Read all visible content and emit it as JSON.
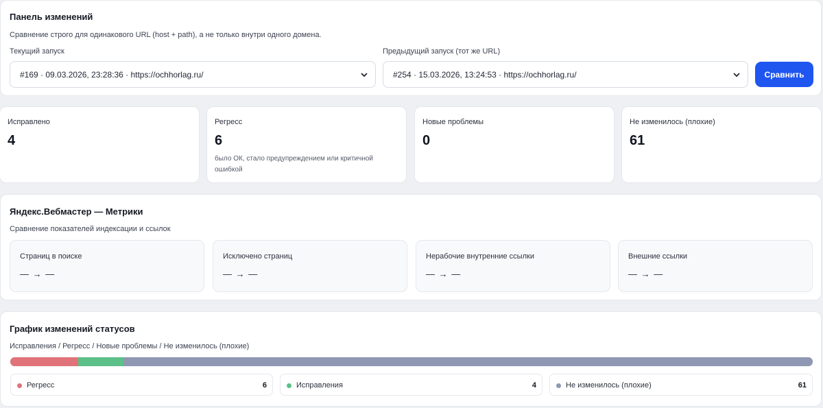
{
  "compare_panel": {
    "title": "Панель изменений",
    "subtitle": "Сравнение строго для одинакового URL (host + path), а не только внутри одного домена.",
    "current_run": {
      "label": "Текущий запуск",
      "value": "#169 · 09.03.2026, 23:28:36 · https://ochhorlag.ru/"
    },
    "previous_run": {
      "label": "Предыдущий запуск (тот же URL)",
      "value": "#254 · 15.03.2026, 13:24:53 · https://ochhorlag.ru/"
    },
    "compare_button": "Сравнить"
  },
  "stats": [
    {
      "label": "Исправлено",
      "value": "4",
      "note": ""
    },
    {
      "label": "Регресс",
      "value": "6",
      "note": "было ОК, стало предупреждением или критичной ошибкой"
    },
    {
      "label": "Новые проблемы",
      "value": "0",
      "note": ""
    },
    {
      "label": "Не изменилось (плохие)",
      "value": "61",
      "note": ""
    }
  ],
  "webmaster": {
    "title": "Яндекс.Вебмастер — Метрики",
    "subtitle": "Сравнение показателей индексации и ссылок",
    "metrics": [
      {
        "label": "Страниц в поиске",
        "value": "— → —"
      },
      {
        "label": "Исключено страниц",
        "value": "— → —"
      },
      {
        "label": "Нерабочие внутренние ссылки",
        "value": "— → —"
      },
      {
        "label": "Внешние ссылки",
        "value": "— → —"
      }
    ]
  },
  "status_chart": {
    "title": "График изменений статусов",
    "subtitle": "Исправления / Регресс / Новые проблемы / Не изменилось (плохие)",
    "legend": [
      {
        "label": "Регресс",
        "count": "6",
        "color": "#e0727a"
      },
      {
        "label": "Исправления",
        "count": "4",
        "color": "#5cc088"
      },
      {
        "label": "Не изменилось (плохие)",
        "count": "61",
        "color": "#8f98b2"
      }
    ]
  },
  "chart_data": {
    "type": "bar",
    "orientation": "horizontal-stacked",
    "categories": [
      "Регресс",
      "Исправления",
      "Новые проблемы",
      "Не изменилось (плохие)"
    ],
    "values": [
      6,
      4,
      0,
      61
    ],
    "colors": [
      "#e0727a",
      "#5cc088",
      "#f0b44c",
      "#8f98b2"
    ]
  },
  "colors": {
    "accent": "#1f56f0",
    "regress": "#e0727a",
    "fixed": "#5cc088",
    "unchanged": "#8f98b2"
  }
}
